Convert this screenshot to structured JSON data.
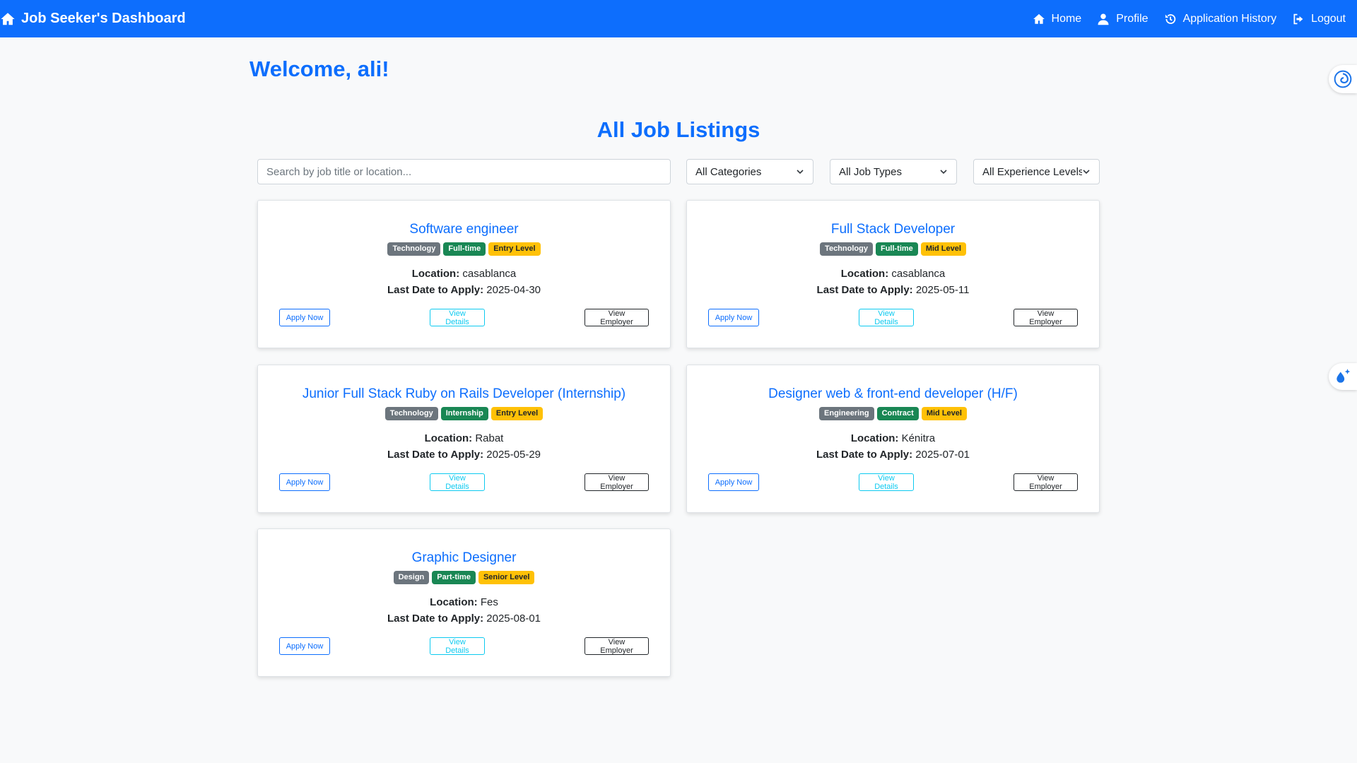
{
  "navbar": {
    "brand": "Job Seeker's Dashboard",
    "brand_icon": "home-icon",
    "links": [
      {
        "label": "Home",
        "icon": "home-icon"
      },
      {
        "label": "Profile",
        "icon": "user-icon"
      },
      {
        "label": "Application History",
        "icon": "history-icon"
      },
      {
        "label": "Logout",
        "icon": "logout-icon"
      }
    ]
  },
  "welcome": "Welcome, ali!",
  "listings": {
    "title": "All Job Listings",
    "search": {
      "placeholder": "Search by job title or location...",
      "value": ""
    },
    "filters": {
      "category": "All Categories",
      "job_type": "All Job Types",
      "experience": "All Experience Levels"
    }
  },
  "labels": {
    "location": "Location:",
    "last_date": "Last Date to Apply:",
    "apply": "Apply Now",
    "details": "View Details",
    "employer": "View Employer"
  },
  "jobs": [
    {
      "title": "Software engineer",
      "category": "Technology",
      "type": "Full-time",
      "level": "Entry Level",
      "location": "casablanca",
      "deadline": "2025-04-30"
    },
    {
      "title": "Full Stack Developer",
      "category": "Technology",
      "type": "Full-time",
      "level": "Mid Level",
      "location": "casablanca",
      "deadline": "2025-05-11"
    },
    {
      "title": "Junior Full Stack Ruby on Rails Developer (Internship)",
      "category": "Technology",
      "type": "Internship",
      "level": "Entry Level",
      "location": "Rabat",
      "deadline": "2025-05-29"
    },
    {
      "title": "Designer web & front-end developer (H/F)",
      "category": "Engineering",
      "type": "Contract",
      "level": "Mid Level",
      "location": "Kénitra",
      "deadline": "2025-07-01"
    },
    {
      "title": "Graphic Designer",
      "category": "Design",
      "type": "Part-time",
      "level": "Senior Level",
      "location": "Fes",
      "deadline": "2025-08-01"
    }
  ],
  "colors": {
    "primary": "#0d6efd",
    "badge_category": "#6c757d",
    "badge_type": "#198754",
    "badge_level": "#ffc107",
    "details_outline": "#0dcaf0",
    "background": "#f8f9fa"
  }
}
